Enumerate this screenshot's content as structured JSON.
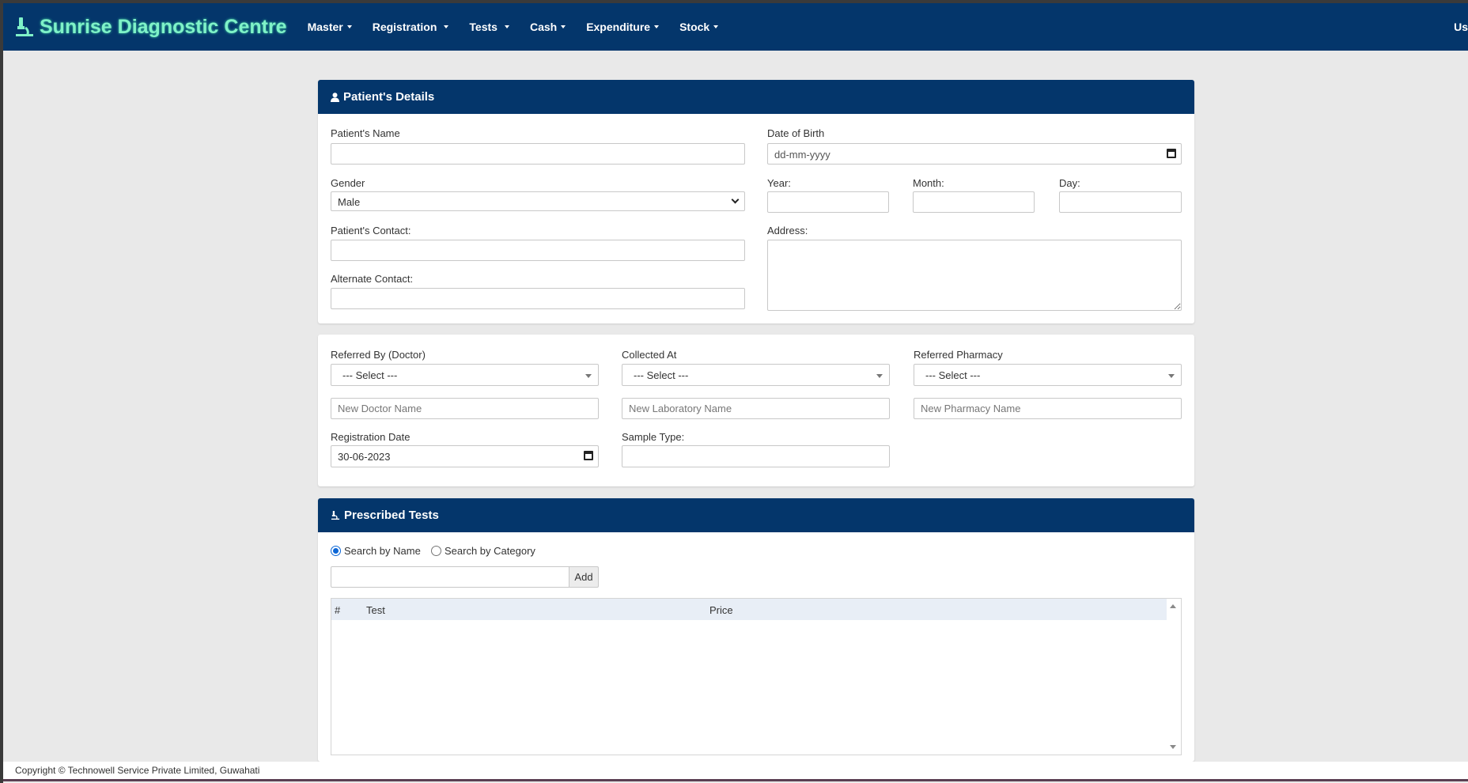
{
  "brand": {
    "title": "Sunrise Diagnostic Centre"
  },
  "nav": {
    "items": [
      "Master",
      "Registration",
      "Tests",
      "Cash",
      "Expenditure",
      "Stock"
    ],
    "user": "Us"
  },
  "patient": {
    "header": "Patient's Details",
    "name_label": "Patient's Name",
    "dob_label": "Date of Birth",
    "dob_placeholder": "dd-mm-yyyy",
    "gender_label": "Gender",
    "gender_value": "Male",
    "year_label": "Year:",
    "month_label": "Month:",
    "day_label": "Day:",
    "contact_label": "Patient's Contact:",
    "address_label": "Address:",
    "alt_contact_label": "Alternate Contact:"
  },
  "referral": {
    "doctor_label": "Referred By (Doctor)",
    "collected_label": "Collected At",
    "pharmacy_label": "Referred Pharmacy",
    "select_text": "--- Select ---",
    "doctor_placeholder": "New Doctor Name",
    "lab_placeholder": "New Laboratory Name",
    "pharmacy_placeholder": "New Pharmacy Name",
    "reg_date_label": "Registration Date",
    "reg_date_value": "30-06-2023",
    "sample_label": "Sample Type:"
  },
  "tests": {
    "header": "Prescribed Tests",
    "search_by_name": "Search by Name",
    "search_by_category": "Search by Category",
    "add_label": "Add",
    "columns": [
      "#",
      "Test",
      "Price"
    ]
  },
  "footer": {
    "text": "Copyright © Technowell Service Private Limited, Guwahati"
  }
}
